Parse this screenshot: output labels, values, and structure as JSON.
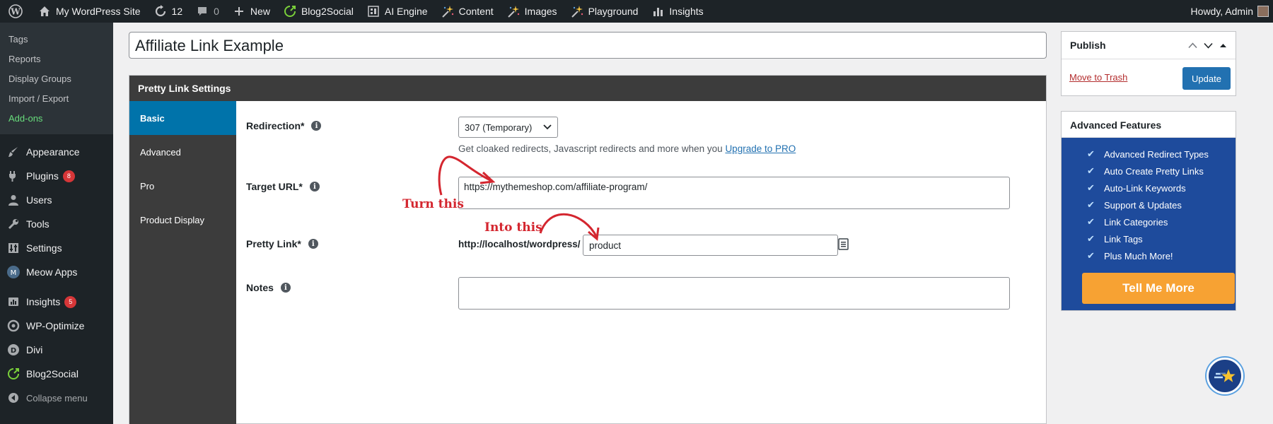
{
  "admin_bar": {
    "site_name": "My WordPress Site",
    "updates_count": "12",
    "comments_count": "0",
    "new_label": "New",
    "blog2social_label": "Blog2Social",
    "ai_engine_label": "AI Engine",
    "content_label": "Content",
    "images_label": "Images",
    "playground_label": "Playground",
    "insights_label": "Insights",
    "greeting": "Howdy, Admin"
  },
  "sidebar": {
    "submenu": [
      "Tags",
      "Reports",
      "Display Groups",
      "Import / Export",
      "Add-ons"
    ],
    "menu": [
      {
        "label": "Appearance",
        "icon": "paintbrush-icon"
      },
      {
        "label": "Plugins",
        "icon": "plug-icon",
        "badge": "8"
      },
      {
        "label": "Users",
        "icon": "users-icon"
      },
      {
        "label": "Tools",
        "icon": "wrench-icon"
      },
      {
        "label": "Settings",
        "icon": "settings-icon"
      },
      {
        "label": "Meow Apps",
        "icon": "meow-apps-icon"
      },
      {
        "label": "Insights",
        "icon": "insights-icon",
        "badge": "5"
      },
      {
        "label": "WP-Optimize",
        "icon": "wp-optimize-icon"
      },
      {
        "label": "Divi",
        "icon": "divi-icon"
      },
      {
        "label": "Blog2Social",
        "icon": "blog2social-icon"
      }
    ],
    "collapse_label": "Collapse menu"
  },
  "post_title": "Affiliate Link Example",
  "pretty_link": {
    "box_title": "Pretty Link Settings",
    "tabs": [
      "Basic",
      "Advanced",
      "Pro",
      "Product Display"
    ],
    "active_tab": "Basic",
    "redirection_label": "Redirection*",
    "redirection_value": "307 (Temporary)",
    "redirection_help": "Get cloaked redirects, Javascript redirects and more when you",
    "upgrade_link": "Upgrade to PRO",
    "target_url_label": "Target URL*",
    "target_url_value": "https://mythemeshop.com/affiliate-program/",
    "pretty_link_label": "Pretty Link*",
    "pretty_link_base": "http://localhost/wordpress/",
    "pretty_link_slug": "product",
    "notes_label": "Notes",
    "notes_value": ""
  },
  "annotations": {
    "turn_this": "Turn this",
    "into_this": "Into this",
    "color": "#d4262f"
  },
  "publish": {
    "title": "Publish",
    "trash_label": "Move to Trash",
    "update_label": "Update"
  },
  "advanced_features": {
    "title": "Advanced Features",
    "items": [
      "Advanced Redirect Types",
      "Auto Create Pretty Links",
      "Auto-Link Keywords",
      "Support & Updates",
      "Link Categories",
      "Link Tags",
      "Plus Much More!"
    ],
    "cta_label": "Tell Me More"
  },
  "colors": {
    "admin_dark": "#1d2327",
    "accent_blue": "#0073aa",
    "button_blue": "#2271b1",
    "promo_blue": "#1e4b9c",
    "cta_orange": "#f7a233"
  }
}
